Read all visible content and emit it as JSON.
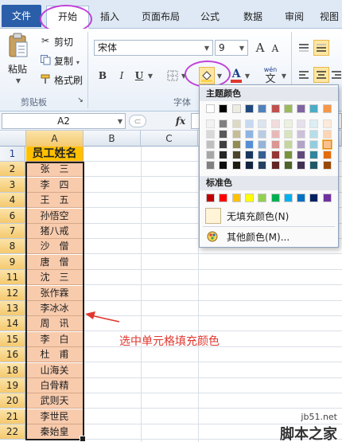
{
  "tabs": [
    {
      "label": "文件"
    },
    {
      "label": "开始"
    },
    {
      "label": "插入"
    },
    {
      "label": "页面布局"
    },
    {
      "label": "公式"
    },
    {
      "label": "数据"
    },
    {
      "label": "审阅"
    },
    {
      "label": "视图"
    }
  ],
  "clipboard": {
    "paste": "粘贴",
    "cut": "剪切",
    "copy": "复制",
    "copy_arrow": "▾",
    "format_painter": "格式刷",
    "group_label": "剪贴板"
  },
  "font": {
    "name": "宋体",
    "size": "9",
    "grow": "A",
    "shrink": "A",
    "bold": "B",
    "italic": "I",
    "underline": "U",
    "wen": "wén",
    "wen_char": "文",
    "group_label": "字体"
  },
  "formula_bar": {
    "name_box": "A2",
    "fx": "fx"
  },
  "columns": [
    "A",
    "B",
    "C",
    "E"
  ],
  "rows": [
    {
      "num": "1",
      "value": "员工姓名"
    },
    {
      "num": "2",
      "value": "张　三"
    },
    {
      "num": "3",
      "value": "李　四"
    },
    {
      "num": "4",
      "value": "王　五"
    },
    {
      "num": "6",
      "value": "孙悟空"
    },
    {
      "num": "7",
      "value": "猪八戒"
    },
    {
      "num": "8",
      "value": "沙　僧"
    },
    {
      "num": "9",
      "value": "唐　僧"
    },
    {
      "num": "11",
      "value": "沈　三"
    },
    {
      "num": "12",
      "value": "张作霖"
    },
    {
      "num": "13",
      "value": "李冰冰"
    },
    {
      "num": "14",
      "value": "周　讯"
    },
    {
      "num": "15",
      "value": "李　白"
    },
    {
      "num": "16",
      "value": "杜　甫"
    },
    {
      "num": "18",
      "value": "山海关"
    },
    {
      "num": "19",
      "value": "白骨精"
    },
    {
      "num": "20",
      "value": "武则天"
    },
    {
      "num": "21",
      "value": "李世民"
    },
    {
      "num": "22",
      "value": "秦始皇"
    }
  ],
  "palette": {
    "theme_title": "主题颜色",
    "standard_title": "标准色",
    "no_fill": "无填充颜色(N)",
    "more_colors": "其他颜色(M)...",
    "theme_top": [
      "#ffffff",
      "#000000",
      "#eeece1",
      "#1f497d",
      "#4f81bd",
      "#c0504d",
      "#9bbb59",
      "#8064a2",
      "#4bacc6",
      "#f79646"
    ],
    "theme_shades": [
      [
        "#f2f2f2",
        "#808080",
        "#ddd9c3",
        "#c6d9f1",
        "#dbe5f1",
        "#f2dcdb",
        "#ebf1de",
        "#e5e0ec",
        "#dbeef4",
        "#fdeada"
      ],
      [
        "#d9d9d9",
        "#595959",
        "#c4bd97",
        "#8eb4e3",
        "#b8cce4",
        "#e6b9b8",
        "#d7e4bd",
        "#ccc1da",
        "#b7dee8",
        "#fcd5b5"
      ],
      [
        "#bfbfbf",
        "#404040",
        "#948a54",
        "#558ed5",
        "#95b3d7",
        "#d99694",
        "#c3d69b",
        "#b3a2c7",
        "#93cddd",
        "#fac08f"
      ],
      [
        "#a6a6a6",
        "#262626",
        "#4a452a",
        "#17375e",
        "#366092",
        "#953735",
        "#77933c",
        "#604a7b",
        "#31859c",
        "#e46c0a"
      ],
      [
        "#808080",
        "#0d0d0d",
        "#1e1c11",
        "#10243f",
        "#244062",
        "#632523",
        "#4f6228",
        "#403152",
        "#205867",
        "#984807"
      ]
    ],
    "standard": [
      "#c00000",
      "#ff0000",
      "#ffc000",
      "#ffff00",
      "#92d050",
      "#00b050",
      "#00b0f0",
      "#0070c0",
      "#002060",
      "#7030a0"
    ]
  },
  "annotation": "选中单元格填充颜色",
  "watermark": {
    "line1": "jb51.net",
    "line2": "脚本之家"
  },
  "colors": {
    "header_fill": "#ffc000",
    "cell_fill": "#f8cbad",
    "annotation": "#e0372e",
    "highlight_ring": "#c042d8"
  }
}
